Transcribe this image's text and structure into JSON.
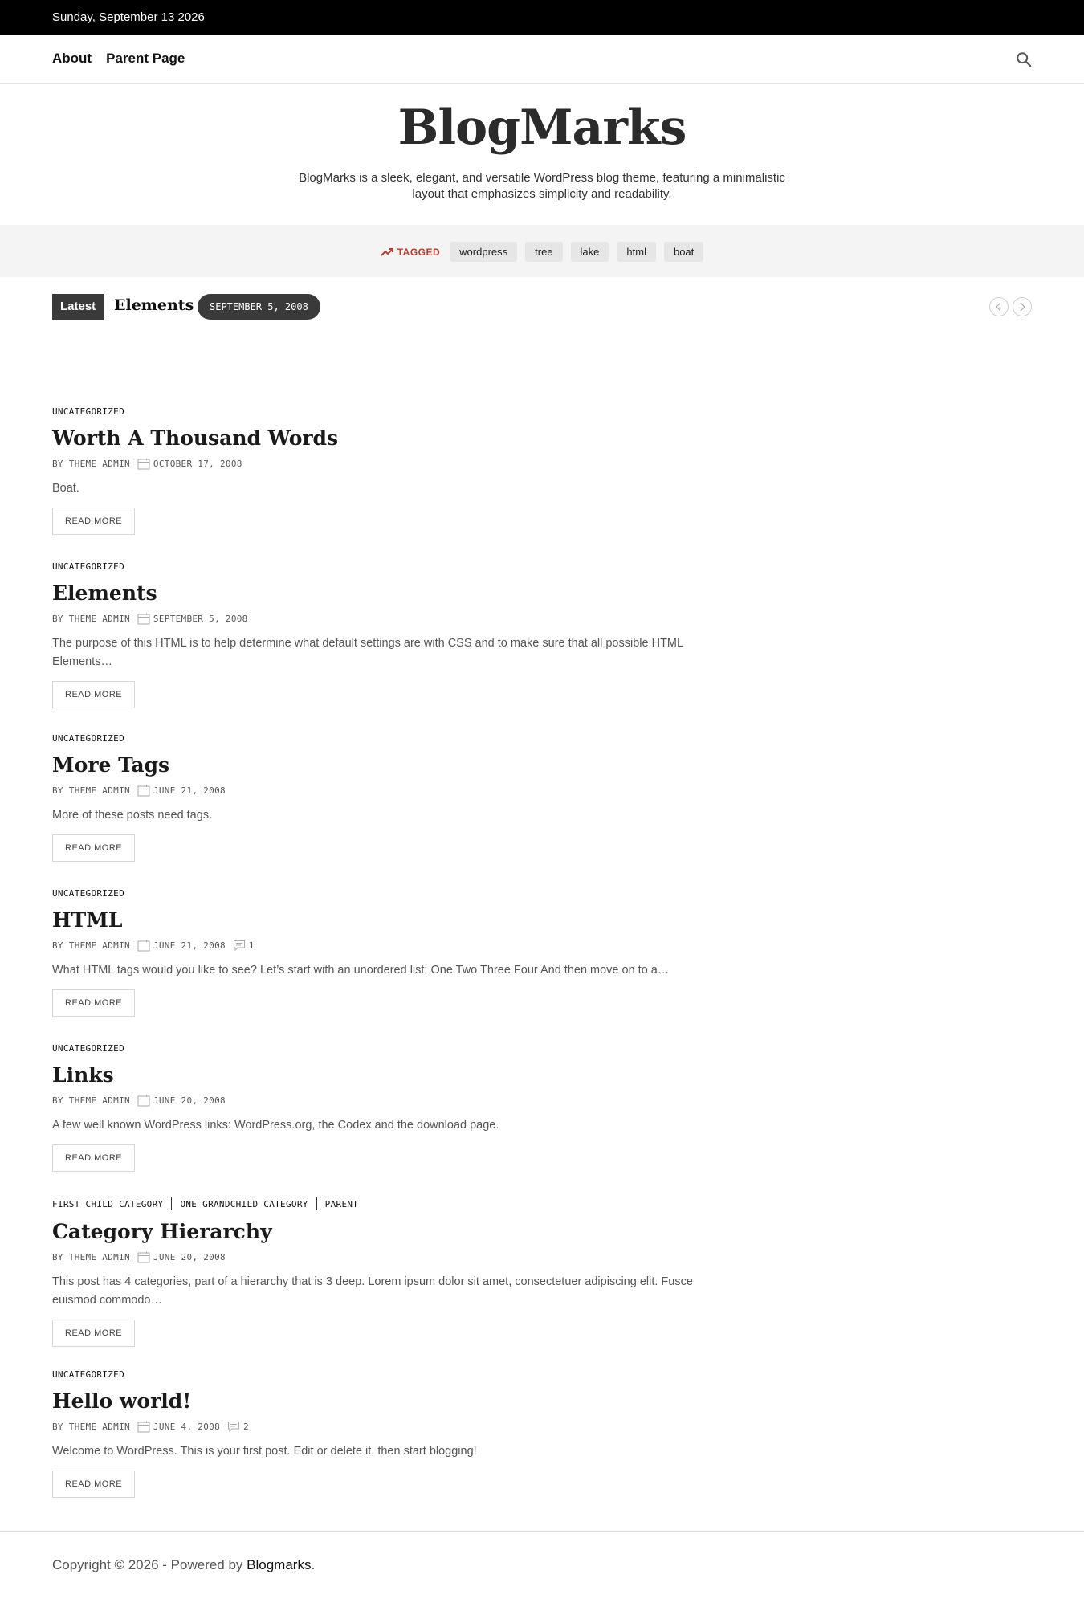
{
  "topbar": {
    "date": "Sunday, September 13 2026"
  },
  "nav": {
    "items": [
      "About",
      "Parent Page"
    ]
  },
  "brand": {
    "title": "BlogMarks",
    "description": "BlogMarks is a sleek, elegant, and versatile WordPress blog theme, featuring a minimalistic layout that emphasizes simplicity and readability."
  },
  "tagbar": {
    "label": "TAGGED",
    "tags": [
      "wordpress",
      "tree",
      "lake",
      "html",
      "boat"
    ]
  },
  "ticker": {
    "label": "Latest",
    "title": "Elements",
    "date": "SEPTEMBER 5, 2008"
  },
  "posts": [
    {
      "categories": [
        "UNCATEGORIZED"
      ],
      "title": "Worth A Thousand Words",
      "author": "BY THEME ADMIN",
      "date": "OCTOBER 17, 2008",
      "comments": "",
      "excerpt": "Boat.",
      "read_more": "READ MORE"
    },
    {
      "categories": [
        "UNCATEGORIZED"
      ],
      "title": "Elements",
      "author": "BY THEME ADMIN",
      "date": "SEPTEMBER 5, 2008",
      "comments": "",
      "excerpt": "The purpose of this HTML is to help determine what default settings are with CSS and to make sure that all possible HTML Elements…",
      "read_more": "READ MORE"
    },
    {
      "categories": [
        "UNCATEGORIZED"
      ],
      "title": "More Tags",
      "author": "BY THEME ADMIN",
      "date": "JUNE 21, 2008",
      "comments": "",
      "excerpt": "More of these posts need tags.",
      "read_more": "READ MORE"
    },
    {
      "categories": [
        "UNCATEGORIZED"
      ],
      "title": "HTML",
      "author": "BY THEME ADMIN",
      "date": "JUNE 21, 2008",
      "comments": "1",
      "excerpt": "What HTML tags would you like to see? Let’s start with an unordered list: One Two Three Four And then move on to a…",
      "read_more": "READ MORE"
    },
    {
      "categories": [
        "UNCATEGORIZED"
      ],
      "title": "Links",
      "author": "BY THEME ADMIN",
      "date": "JUNE 20, 2008",
      "comments": "",
      "excerpt": "A few well known WordPress links: WordPress.org, the Codex and the download page.",
      "read_more": "READ MORE"
    },
    {
      "categories": [
        "FIRST CHILD CATEGORY",
        "ONE GRANDCHILD CATEGORY",
        "PARENT"
      ],
      "title": "Category Hierarchy",
      "author": "BY THEME ADMIN",
      "date": "JUNE 20, 2008",
      "comments": "",
      "excerpt": "This post has 4 categories, part of a hierarchy that is 3 deep. Lorem ipsum dolor sit amet, consectetuer adipiscing elit. Fusce euismod commodo…",
      "read_more": "READ MORE"
    },
    {
      "categories": [
        "UNCATEGORIZED"
      ],
      "title": "Hello world!",
      "author": "BY THEME ADMIN",
      "date": "JUNE 4, 2008",
      "comments": "2",
      "excerpt": "Welcome to WordPress. This is your first post. Edit or delete it, then start blogging!",
      "read_more": "READ MORE"
    }
  ],
  "footer": {
    "copyright": "Copyright © 2026 - Powered by ",
    "link": "Blogmarks",
    "suffix": "."
  },
  "colors": {
    "topbar": "#000000",
    "accent": "#c0392b",
    "badge": "#3a3a3a",
    "tagbar": "#f4f4f4"
  },
  "icons": {
    "search": "search-icon",
    "trend": "trending-up-icon",
    "calendar": "calendar-icon",
    "comment": "comment-icon",
    "prev": "chevron-left-icon",
    "next": "chevron-right-icon"
  }
}
